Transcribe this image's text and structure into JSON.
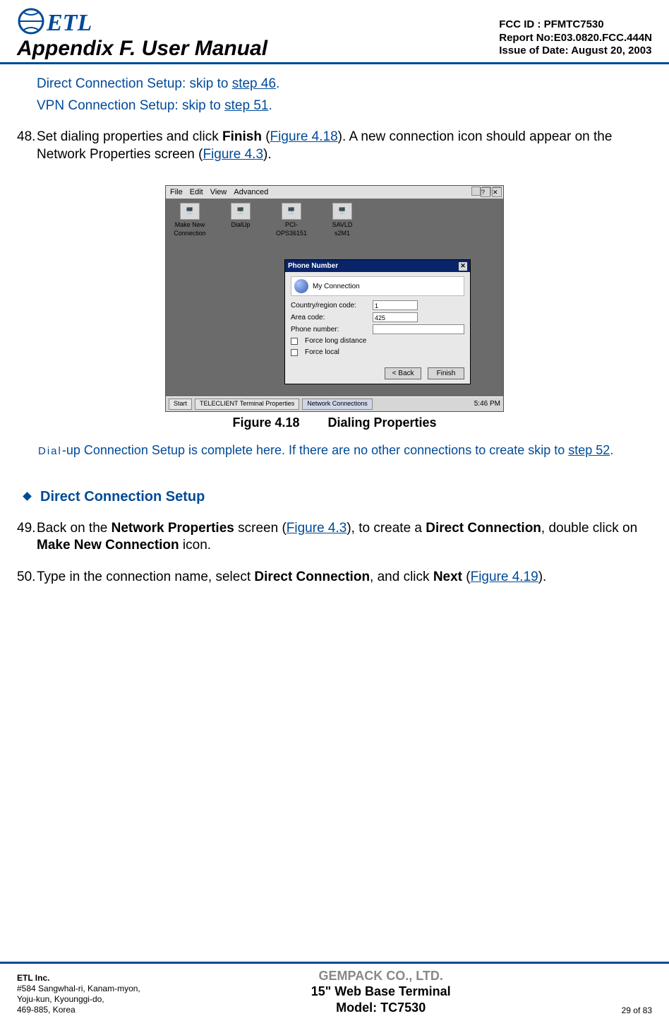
{
  "header": {
    "appendix_title": "Appendix F. User Manual",
    "fcc_id": "FCC ID : PFMTC7530",
    "report_no": "Report No:E03.0820.FCC.444N",
    "issue_date": "Issue of Date:  August 20, 2003"
  },
  "skip": {
    "direct_pre": "Direct Connection Setup: skip to ",
    "direct_link": "step 46",
    "vpn_pre": "VPN Connection Setup: skip to ",
    "vpn_link": "step 51",
    "period": "."
  },
  "step48": {
    "num": "48.",
    "t1": "Set dialing properties and click ",
    "finish": "Finish",
    "open_paren": " (",
    "fig418": "Figure 4.18",
    "t2": ").  A new connection icon should appear on the Network Properties screen (",
    "fig43": "Figure 4.3",
    "close": ")."
  },
  "figure": {
    "menubar": {
      "file": "File",
      "edit": "Edit",
      "view": "View",
      "adv": "Advanced"
    },
    "desk": {
      "i1": "Make New Connection",
      "i2": "DialUp",
      "i3": "PCI-OPS36151",
      "i4": "SAVLD s2M1"
    },
    "win_titlebar_q": "?",
    "win_titlebar_x": "✕",
    "dialog": {
      "title": "Phone Number",
      "conn_label": "My Connection",
      "country_lbl": "Country/region code:",
      "area_lbl": "Area code:",
      "area_val": "425",
      "phone_lbl": "Phone number:",
      "force_long": "Force long distance",
      "force_local": "Force local",
      "back": "< Back",
      "finish": "Finish"
    },
    "taskbar": {
      "start": "Start",
      "t1": "TELECLIENT Terminal Properties",
      "t2": "Network Connections",
      "time": "5:46 PM"
    },
    "caption_num": "Figure 4.18",
    "caption_title": "Dialing Properties"
  },
  "note": {
    "dial": "Dial",
    "rest": "-up Connection Setup is complete here.  If there are no other connections to create skip to  ",
    "step52": "step 52",
    "period": "."
  },
  "section": {
    "title": "Direct Connection Setup"
  },
  "step49": {
    "num": "49.",
    "t1": "Back on the ",
    "np": "Network Properties",
    "t2": " screen (",
    "fig43": "Figure 4.3",
    "t3": "), to create a ",
    "dc": "Direct Connection",
    "t4": ", double click on ",
    "mnc": "Make New Connection",
    "t5": " icon."
  },
  "step50": {
    "num": "50.",
    "t1": "Type in the connection name, select ",
    "dc": "Direct Connection",
    "t2": ", and click ",
    "next": "Next",
    "open": " (",
    "fig419": "Figure 4.19",
    "close": ")."
  },
  "footer": {
    "etl": "ETL Inc.",
    "addr1": "#584 Sangwhal-ri, Kanam-myon,",
    "addr2": "Yoju-kun, Kyounggi-do,",
    "addr3": "469-885, Korea",
    "gempack": "GEMPACK CO., LTD.",
    "product": "15\" Web Base Terminal",
    "model": "Model: TC7530",
    "page": "29 of  83"
  }
}
